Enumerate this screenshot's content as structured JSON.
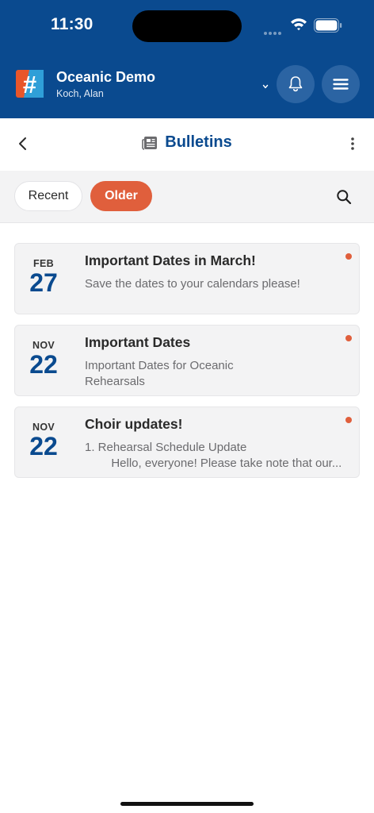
{
  "status_bar": {
    "time": "11:30"
  },
  "header": {
    "logo_icon": "hashtag-logo-icon",
    "org_name": "Oceanic Demo",
    "user_name": "Koch, Alan",
    "bell_icon": "bell-icon",
    "menu_icon": "hamburger-menu-icon",
    "background_color": "#0a4a8f"
  },
  "title_bar": {
    "title": "Bulletins",
    "title_icon": "newspaper-icon",
    "back_icon": "chevron-left-icon",
    "more_icon": "vertical-ellipsis-icon"
  },
  "filters": {
    "tabs": [
      {
        "label": "Recent",
        "selected": false
      },
      {
        "label": "Older",
        "selected": true
      }
    ],
    "search_icon": "search-icon",
    "active_color": "#e05f3c"
  },
  "bulletins": [
    {
      "month": "FEB",
      "day": "27",
      "title": "Important Dates in March!",
      "summary": "Save the dates to your calendars please!",
      "unread": true
    },
    {
      "month": "NOV",
      "day": "22",
      "title": "Important Dates",
      "summary": "Important Dates for Oceanic\nRehearsals",
      "unread": true
    },
    {
      "month": "NOV",
      "day": "22",
      "title": "Choir updates!",
      "summary": "1. Rehearsal Schedule Update\n        Hello, everyone! Please take note that our...",
      "unread": true
    }
  ]
}
